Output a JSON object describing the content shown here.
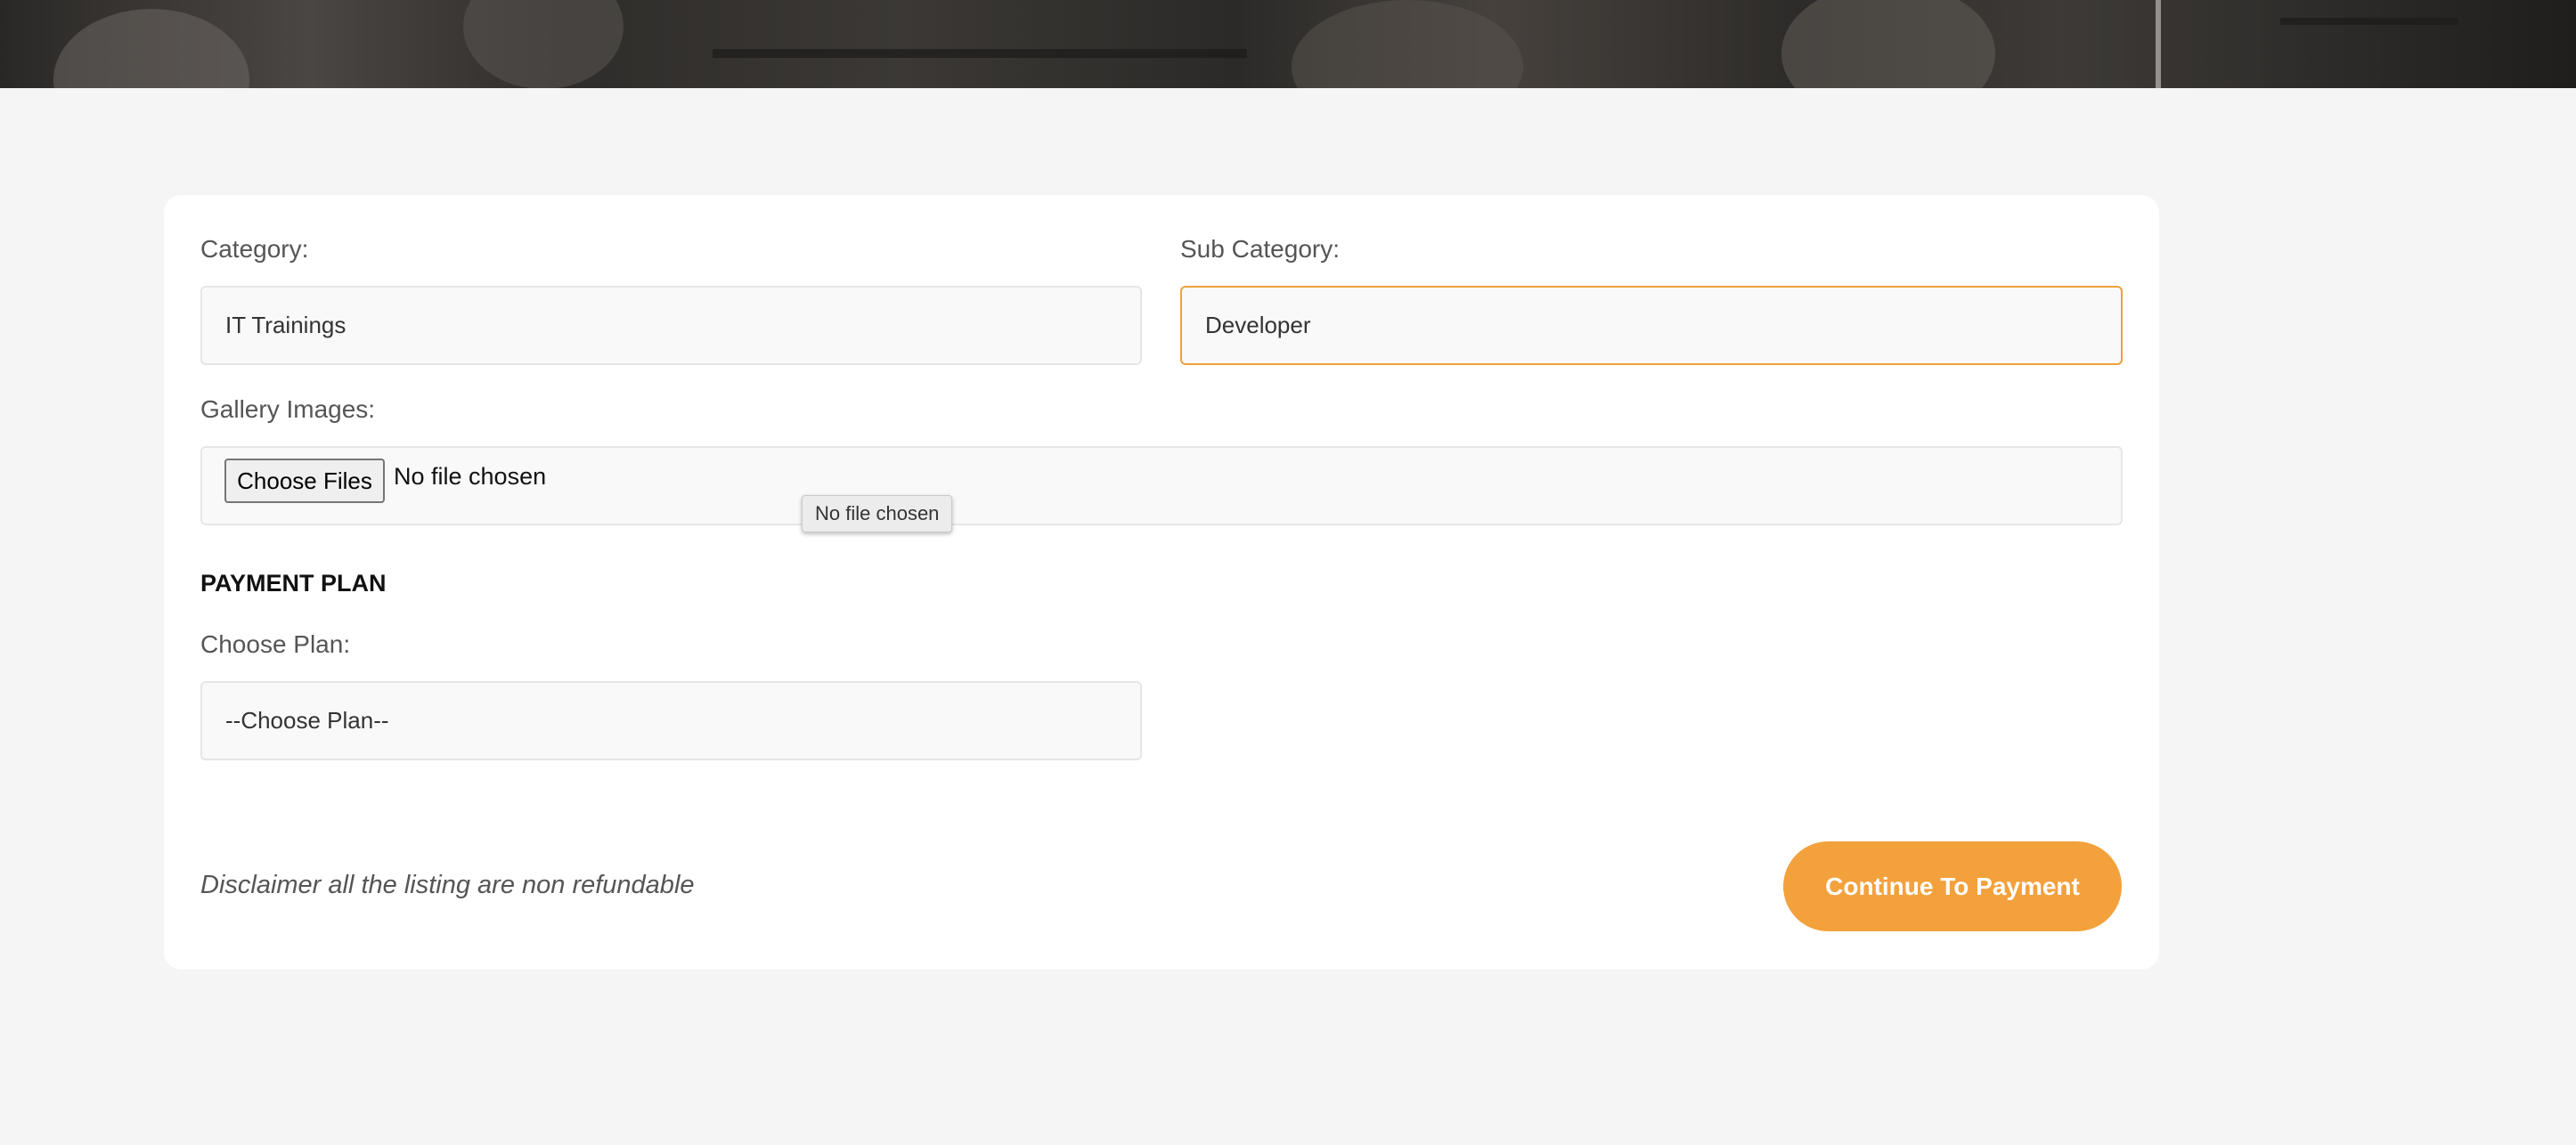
{
  "form": {
    "category_label": "Category:",
    "category_value": "IT Trainings",
    "subcategory_label": "Sub Category:",
    "subcategory_value": "Developer",
    "gallery_label": "Gallery Images:",
    "choose_files_label": "Choose Files",
    "file_status": "No file chosen",
    "file_tooltip": "No file chosen"
  },
  "payment": {
    "section_title": "PAYMENT PLAN",
    "plan_label": "Choose Plan:",
    "plan_value": "--Choose Plan--"
  },
  "footer": {
    "disclaimer": "Disclaimer all the listing are non refundable",
    "continue_label": "Continue To Payment"
  },
  "colors": {
    "accent": "#f3a13c",
    "focus_border": "#f0a03a",
    "page_bg": "#f5f5f5"
  }
}
